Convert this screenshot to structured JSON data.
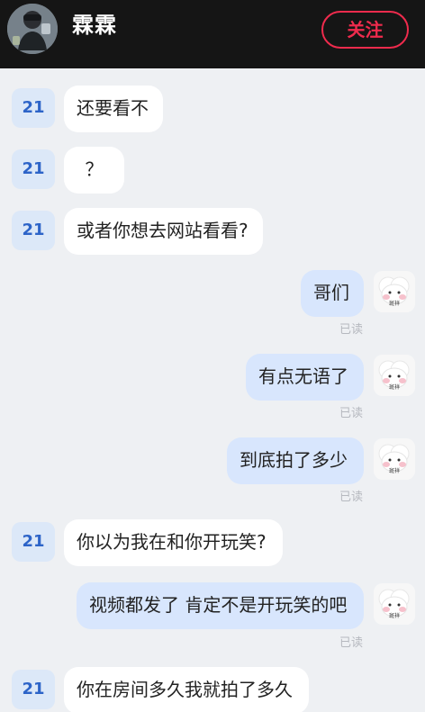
{
  "header": {
    "title": "霖霖",
    "follow_label": "关注"
  },
  "messages": [
    {
      "side": "received",
      "avatar_label": "21",
      "text": "还要看不"
    },
    {
      "side": "received",
      "avatar_label": "21",
      "text": "？"
    },
    {
      "side": "received",
      "avatar_label": "21",
      "text": "或者你想去网站看看?"
    },
    {
      "side": "sent",
      "text": "哥们",
      "status": "已读",
      "avatar_caption": "斑祥"
    },
    {
      "side": "sent",
      "text": "有点无语了",
      "status": "已读",
      "avatar_caption": "斑祥"
    },
    {
      "side": "sent",
      "text": "到底拍了多少",
      "status": "已读",
      "avatar_caption": "斑祥"
    },
    {
      "side": "received",
      "avatar_label": "21",
      "text": "你以为我在和你开玩笑?"
    },
    {
      "side": "sent",
      "text": "视频都发了 肯定不是开玩笑的吧",
      "status": "已读",
      "avatar_caption": "斑祥"
    },
    {
      "side": "received",
      "avatar_label": "21",
      "text": "你在房间多久我就拍了多久"
    }
  ],
  "colors": {
    "header_bg": "#151515",
    "follow_accent": "#ef2b4d",
    "chat_bg": "#eef0f3",
    "sent_bubble": "#d8e6fd",
    "received_bubble": "#ffffff",
    "small_avatar_bg": "#dce8f8",
    "small_avatar_text": "#2d64c8"
  }
}
